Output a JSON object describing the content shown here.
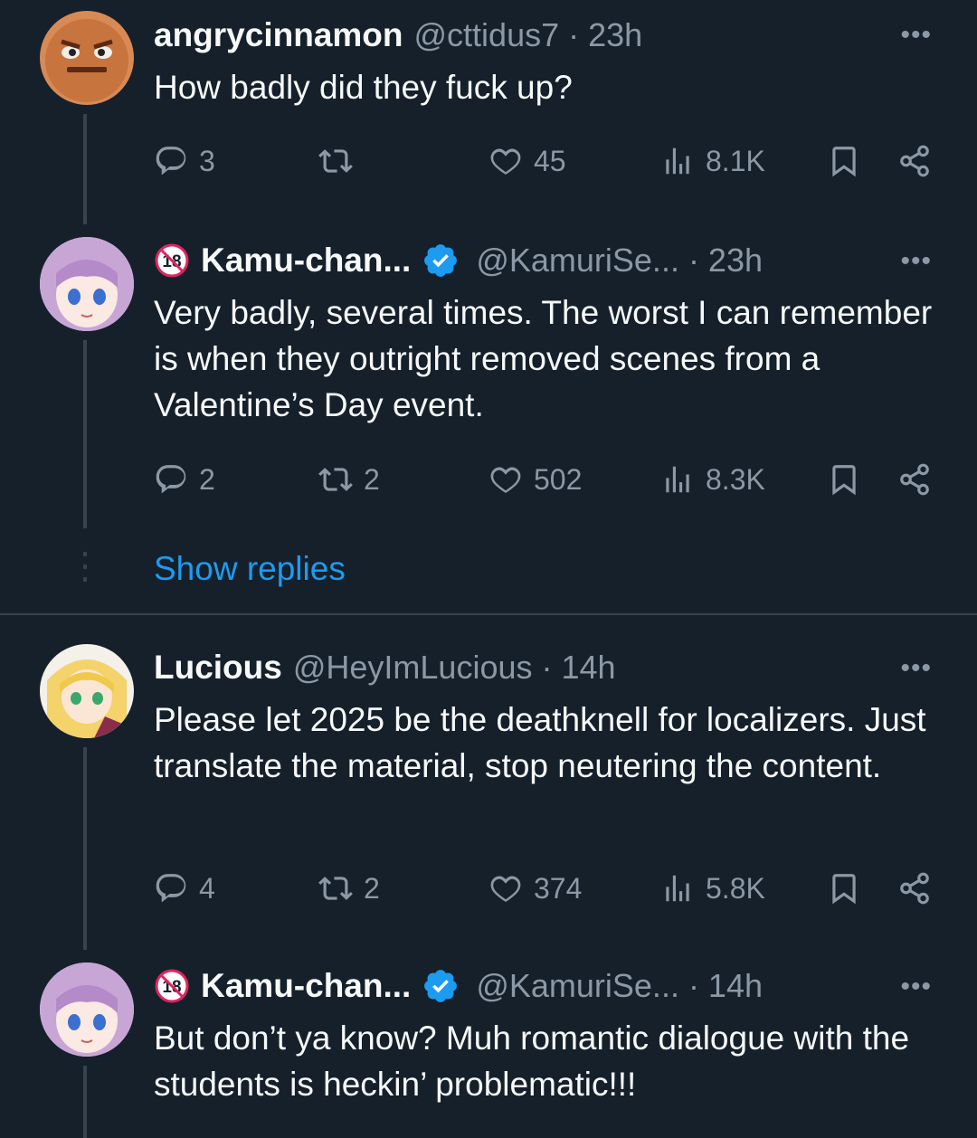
{
  "tweets": [
    {
      "name": "angrycinnamon",
      "handle": "@cttidus7 · 23h",
      "more": "•••",
      "text": "How badly did they fuck up?",
      "replies": "3",
      "retweets": "",
      "likes": "45",
      "views": "8.1K"
    },
    {
      "name": "Kamu-chan...",
      "handle": "@KamuriSe... · 23h",
      "more": "•••",
      "text": "Very badly, several times. The worst I can remember is when they outright removed scenes from a Valentine’s Day event.",
      "replies": "2",
      "retweets": "2",
      "likes": "502",
      "views": "8.3K"
    },
    {
      "name": "Lucious",
      "handle": "@HeyImLucious · 14h",
      "more": "•••",
      "text": "Please let 2025 be the deathknell for localizers. Just translate the material, stop neutering the content.",
      "replies": "4",
      "retweets": "2",
      "likes": "374",
      "views": "5.8K"
    },
    {
      "name": "Kamu-chan...",
      "handle": "@KamuriSe... · 14h",
      "more": "•••",
      "text": "But don’t ya know? Muh romantic dialogue with the students is heckin’ problematic!!!"
    }
  ],
  "show_replies": "Show replies",
  "colors": {
    "background": "#15202b",
    "text": "#f7f9f9",
    "secondary": "#8b98a5",
    "accent": "#1d9bf0",
    "line": "#38444d"
  }
}
